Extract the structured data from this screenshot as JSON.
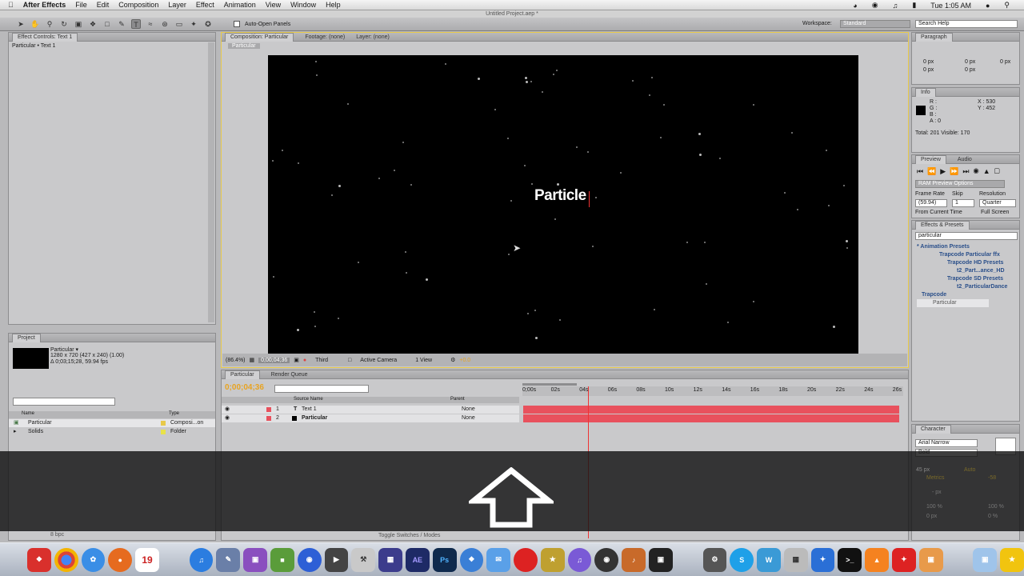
{
  "menubar": {
    "app_name": "After Effects",
    "items": [
      "File",
      "Edit",
      "Composition",
      "Layer",
      "Effect",
      "Animation",
      "View",
      "Window",
      "Help"
    ],
    "clock": "Tue 1:05 AM"
  },
  "window": {
    "title": "Untitled Project.aep *"
  },
  "toolbar": {
    "auto_open_label": "Auto-Open Panels",
    "workspace_label": "Workspace:",
    "workspace_value": "Standard",
    "search_placeholder": "Search Help"
  },
  "effect_controls": {
    "tab": "Effect Controls: Text 1",
    "subtitle": "Particular • Text 1"
  },
  "project": {
    "tab": "Project",
    "comp_name": "Particular ▾",
    "comp_info": "1280 x 720  (427 x 240) (1.00)",
    "comp_duration": "Δ 0;03;15;28, 59.94 fps",
    "columns": {
      "name": "Name",
      "type": "Type"
    },
    "items": [
      {
        "name": "Particular",
        "type": "Composi...on"
      },
      {
        "name": "Solids",
        "type": "Folder"
      }
    ],
    "bpc": "8 bpc"
  },
  "viewer": {
    "tabs": [
      "Composition: Particular",
      "Footage: (none)",
      "Layer: (none)"
    ],
    "breadcrumb": "Particular",
    "overlay_text": "Particle",
    "zoom": "(86.4%)",
    "timecode": "0;00;04;36",
    "resolution": "Third",
    "camera": "Active Camera",
    "views": "1 View",
    "exposure": "+0.0"
  },
  "timeline": {
    "tabs": [
      "Particular",
      "Render Queue"
    ],
    "current_time": "0;00;04;36",
    "columns": {
      "source_name": "Source Name",
      "parent": "Parent"
    },
    "ruler": [
      "0;00s",
      "02s",
      "04s",
      "06s",
      "08s",
      "10s",
      "12s",
      "14s",
      "16s",
      "18s",
      "20s",
      "22s",
      "24s",
      "26s"
    ],
    "layers": [
      {
        "num": "1",
        "name": "Text 1",
        "parent": "None"
      },
      {
        "num": "2",
        "name": "Particular",
        "parent": "None"
      }
    ],
    "toggle_label": "Toggle Switches / Modes"
  },
  "paragraph": {
    "tab": "Paragraph",
    "values": [
      "0 px",
      "0 px",
      "0 px",
      "0 px",
      "0 px"
    ]
  },
  "info": {
    "tab": "Info",
    "r": "R :",
    "g": "G :",
    "b": "B :",
    "a": "A : 0",
    "x": "X : 530",
    "y": "Y : 452",
    "totals": "Total: 201  Visible: 170"
  },
  "preview": {
    "tabs": [
      "Preview",
      "Audio"
    ],
    "ram_options": "RAM Preview Options",
    "frame_rate_label": "Frame Rate",
    "skip_label": "Skip",
    "resolution_label": "Resolution",
    "frame_rate": "(59.94)",
    "skip": "1",
    "resolution": "Quarter",
    "from_current": "From Current Time",
    "full_screen": "Full Screen"
  },
  "effects_presets": {
    "tab": "Effects & Presets",
    "search_value": "particular",
    "tree": [
      "* Animation Presets",
      "Trapcode Particular ffx",
      "Trapcode HD Presets",
      "t2_Part...ance_HD",
      "Trapcode SD Presets",
      "t2_ParticularDance",
      "Trapcode",
      "Particular"
    ]
  },
  "character": {
    "tab": "Character",
    "font": "Arial Narrow",
    "style": "Bold",
    "size": "45 px",
    "leading": "Auto",
    "kerning": "Metrics",
    "tracking": "-58",
    "stroke": "- px",
    "vscale": "100 %",
    "hscale": "100 %",
    "baseline": "0 px",
    "tsume": "0 %"
  },
  "dock": {
    "calendar_day": "19",
    "ae": "AE",
    "ps": "Ps"
  },
  "colors": {
    "accent_orange": "#f5a623",
    "layer_bar": "#e8515d",
    "panel_bg": "#c9c9cb"
  }
}
